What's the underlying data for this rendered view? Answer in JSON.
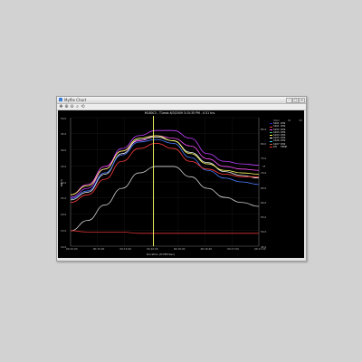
{
  "window": {
    "title": "Myfile Chart",
    "buttons": {
      "minimize": "–",
      "maximize": "□",
      "close": "×"
    }
  },
  "toolbar": {
    "icons": [
      {
        "name": "pan-icon",
        "glyph": "✥"
      },
      {
        "name": "zoom-in-icon",
        "glyph": "⊕"
      },
      {
        "name": "zoom-out-icon",
        "glyph": "⊖"
      },
      {
        "name": "zoom-box-icon",
        "glyph": "⌕"
      },
      {
        "name": "reset-icon",
        "glyph": "⟲"
      }
    ]
  },
  "chart_data": {
    "type": "line",
    "title": "M180C3 - T1ests 6/3/2009 3:15:35 PM - 0.51 hrs.",
    "xlabel": "Duration (H:MM:Sec)",
    "ylabel_left": "RH %",
    "ylabel_right": "°F",
    "x_ticks": [
      "00:15:00",
      "00:15:20",
      "00:15:40",
      "00:16:00",
      "00:16:20",
      "00:16:40",
      "00:17:00",
      "00:17:20"
    ],
    "y_ticks_left": [
      "50.0",
      "45.0",
      "40.0",
      "35.0",
      "30.0",
      "25.0",
      "20.0",
      "15.0",
      "10.0"
    ],
    "y_ticks_right": [
      "85.0",
      "80.0",
      "75.0",
      "70.0",
      "65.0",
      "60.0",
      "55.0",
      "50.0",
      "45.0"
    ],
    "cursor_x": 0.44,
    "legend": {
      "header": [
        "Color",
        "ID",
        "Ch"
      ],
      "entries": [
        {
          "id": "S101",
          "ch": "RH2",
          "color": "#2020d0"
        },
        {
          "id": "S101",
          "ch": "RH2",
          "color": "#e04040"
        },
        {
          "id": "S102",
          "ch": "RH2",
          "color": "#ff40ff"
        },
        {
          "id": "S103",
          "ch": "RH2",
          "color": "#30c060"
        },
        {
          "id": "S104",
          "ch": "RH2",
          "color": "#ffff40"
        },
        {
          "id": "S105",
          "ch": "RH2",
          "color": "#ffffff"
        },
        {
          "id": "S106",
          "ch": "RH2",
          "color": "#30d0ff"
        },
        {
          "id": "S107",
          "ch": "RH2",
          "color": "#c06030"
        },
        {
          "id": "RH",
          "ch": "TEMP",
          "color": "#ff3030"
        }
      ]
    },
    "series": [
      {
        "name": "purple",
        "color": "#c040ff",
        "values": [
          0.62,
          0.55,
          0.4,
          0.24,
          0.14,
          0.1,
          0.1,
          0.16,
          0.28,
          0.34,
          0.36,
          0.37
        ]
      },
      {
        "name": "magenta",
        "color": "#ff50ff",
        "values": [
          0.6,
          0.52,
          0.38,
          0.26,
          0.18,
          0.14,
          0.16,
          0.22,
          0.32,
          0.38,
          0.4,
          0.41
        ]
      },
      {
        "name": "white",
        "color": "#f2f2f2",
        "values": [
          0.64,
          0.58,
          0.44,
          0.28,
          0.17,
          0.15,
          0.18,
          0.27,
          0.35,
          0.42,
          0.45,
          0.47
        ]
      },
      {
        "name": "yellow",
        "color": "#ffff60",
        "values": [
          0.6,
          0.53,
          0.4,
          0.26,
          0.16,
          0.14,
          0.18,
          0.28,
          0.36,
          0.41,
          0.43,
          0.44
        ]
      },
      {
        "name": "blue",
        "color": "#4a7bff",
        "values": [
          0.63,
          0.57,
          0.43,
          0.29,
          0.19,
          0.17,
          0.2,
          0.31,
          0.41,
          0.47,
          0.5,
          0.52
        ]
      },
      {
        "name": "red",
        "color": "#ff3c3c",
        "values": [
          0.66,
          0.6,
          0.48,
          0.34,
          0.24,
          0.2,
          0.24,
          0.34,
          0.4,
          0.44,
          0.46,
          0.46
        ]
      },
      {
        "name": "grey",
        "color": "#cfcfcf",
        "values": [
          0.88,
          0.8,
          0.68,
          0.55,
          0.43,
          0.38,
          0.38,
          0.46,
          0.55,
          0.62,
          0.66,
          0.69
        ]
      },
      {
        "name": "temperature",
        "color": "#d83030",
        "values": [
          0.88,
          0.89,
          0.89,
          0.89,
          0.9,
          0.9,
          0.9,
          0.9,
          0.9,
          0.9,
          0.9,
          0.9
        ]
      }
    ]
  }
}
